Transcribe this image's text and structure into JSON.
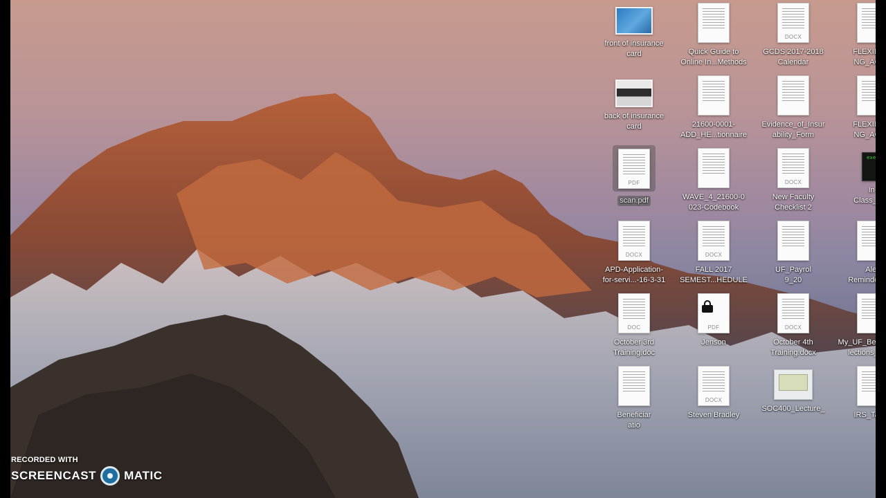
{
  "desktop": {
    "files": [
      {
        "label": "front of insurance\ncard",
        "type": "card-blue",
        "ext": ""
      },
      {
        "label": "Quick Guide to\nOnline In...Methods",
        "type": "doc",
        "ext": ""
      },
      {
        "label": "GCDS 2017-2018\nCalendar",
        "type": "doc",
        "ext": "DOCX"
      },
      {
        "label": "FLEXIBLE_\nNG_ACC...",
        "type": "doc",
        "ext": ""
      },
      {
        "label": "back of insurance\ncard",
        "type": "card-dark",
        "ext": ""
      },
      {
        "label": "21600-0001-\nADD_HE...tionnaire",
        "type": "doc",
        "ext": ""
      },
      {
        "label": "Evidence_of_Insur\nability_Form",
        "type": "doc",
        "ext": ""
      },
      {
        "label": "FLEXIBLE_\nNG_ACC...",
        "type": "doc",
        "ext": ""
      },
      {
        "label": "scan.pdf",
        "type": "doc",
        "ext": "PDF",
        "selected": true
      },
      {
        "label": "WAVE_4_21600-0\n023-Codebook",
        "type": "doc",
        "ext": ""
      },
      {
        "label": "New Faculty\nChecklist 2",
        "type": "doc",
        "ext": "DOCX"
      },
      {
        "label": "In-\nClass_Ex...",
        "type": "exec",
        "ext": "exec"
      },
      {
        "label": "APD-Application-\nfor-servi...-16-3-31",
        "type": "doc",
        "ext": "DOCX"
      },
      {
        "label": "FALL 2017\nSEMEST...HEDULE",
        "type": "doc",
        "ext": "DOCX"
      },
      {
        "label": "UF_Payrol\n9_20",
        "type": "doc",
        "ext": ""
      },
      {
        "label": "Alex\nReminders.pdf",
        "type": "doc",
        "ext": ""
      },
      {
        "label": "October 3rd\nTraining.doc",
        "type": "doc",
        "ext": "DOC"
      },
      {
        "label": "Jenson",
        "type": "lock",
        "ext": "PDF"
      },
      {
        "label": "October 4th\nTraining.docx",
        "type": "doc",
        "ext": "DOCX"
      },
      {
        "label": "My_UF_Benefits_Se\nlections_ALEX",
        "type": "doc",
        "ext": ""
      },
      {
        "label": "Beneficiar\natio",
        "type": "doc",
        "ext": ""
      },
      {
        "label": "Steven Bradley",
        "type": "doc",
        "ext": "DOCX"
      },
      {
        "label": "SOC400_Lecture_",
        "type": "presentation",
        "ext": ""
      },
      {
        "label": "IRS_Tax_A",
        "type": "doc",
        "ext": ""
      }
    ]
  },
  "watermark": {
    "top": "RECORDED WITH",
    "left": "SCREENCAST",
    "right": "MATIC"
  }
}
